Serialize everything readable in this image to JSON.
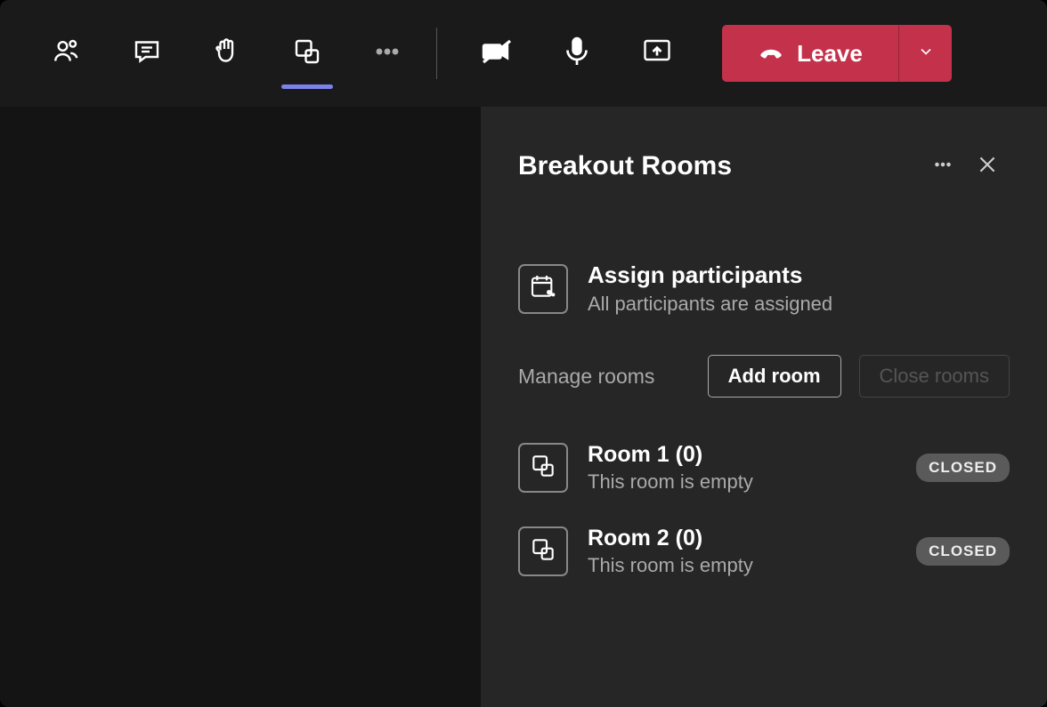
{
  "toolbar": {
    "leave_label": "Leave"
  },
  "panel": {
    "title": "Breakout Rooms",
    "assign": {
      "title": "Assign participants",
      "subtitle": "All participants are assigned"
    },
    "manage_label": "Manage rooms",
    "add_room_label": "Add room",
    "close_rooms_label": "Close rooms",
    "rooms": [
      {
        "title": "Room 1 (0)",
        "subtitle": "This room is empty",
        "status": "CLOSED"
      },
      {
        "title": "Room 2 (0)",
        "subtitle": "This room is empty",
        "status": "CLOSED"
      }
    ]
  }
}
